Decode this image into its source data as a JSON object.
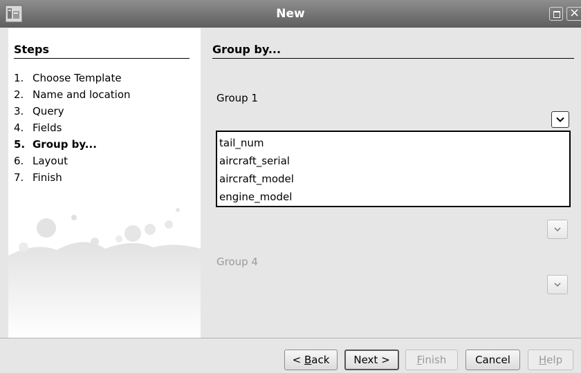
{
  "window": {
    "title": "New",
    "icon": "netbeans-app-icon"
  },
  "steps": {
    "title": "Steps",
    "items": [
      {
        "num": "1.",
        "label": "Choose Template"
      },
      {
        "num": "2.",
        "label": "Name and location"
      },
      {
        "num": "3.",
        "label": "Query"
      },
      {
        "num": "4.",
        "label": "Fields"
      },
      {
        "num": "5.",
        "label": "Group by...",
        "current": true
      },
      {
        "num": "6.",
        "label": "Layout"
      },
      {
        "num": "7.",
        "label": "Finish"
      }
    ]
  },
  "main": {
    "title": "Group by...",
    "group1": {
      "label": "Group 1"
    },
    "group4": {
      "label": "Group 4"
    },
    "dropdown_options": [
      "tail_num",
      "aircraft_serial",
      "aircraft_model",
      "engine_model"
    ]
  },
  "buttons": {
    "back": {
      "prefix": "< ",
      "mnemonic": "B",
      "rest": "ack"
    },
    "next": {
      "label": "Next >"
    },
    "finish": {
      "mnemonic": "F",
      "rest": "inish"
    },
    "cancel": {
      "label": "Cancel"
    },
    "help": {
      "mnemonic": "H",
      "rest": "elp"
    }
  }
}
